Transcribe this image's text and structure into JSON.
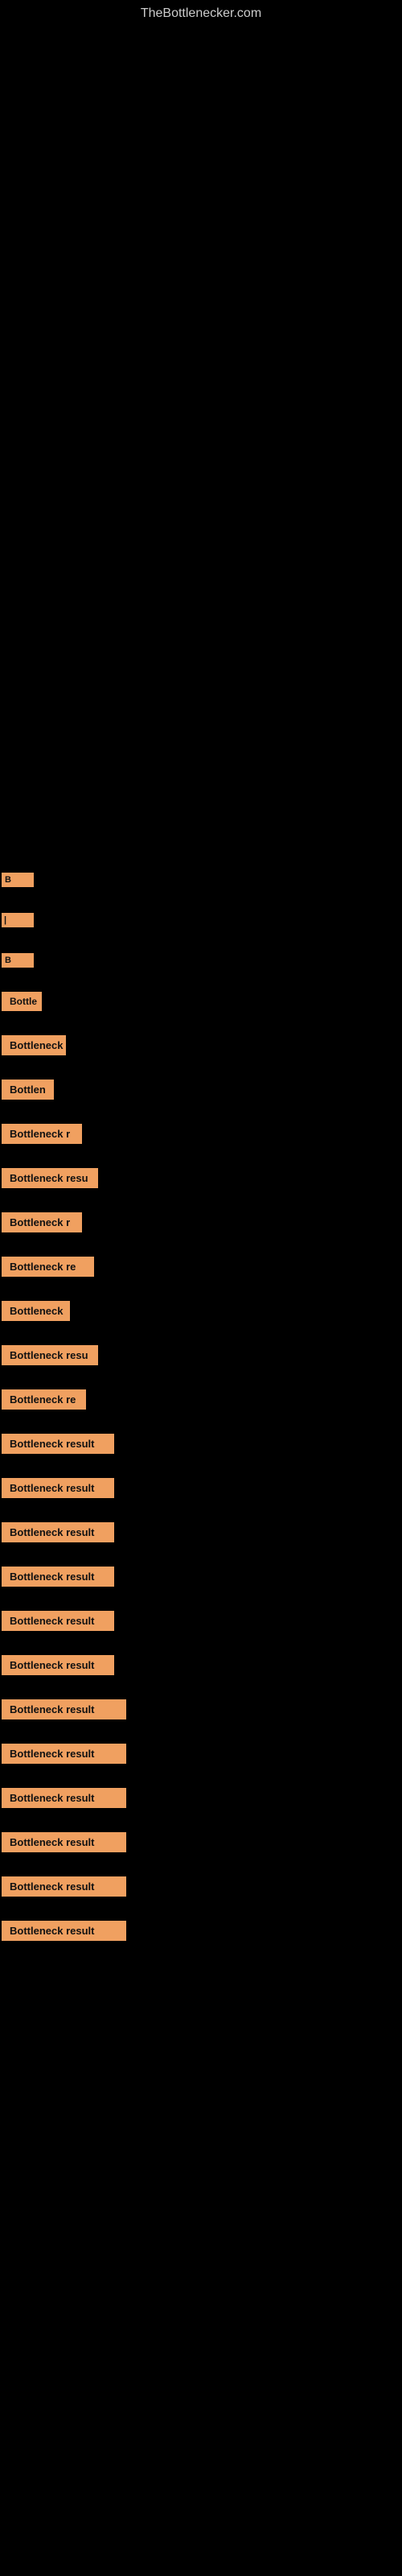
{
  "site": {
    "title": "TheBottlenecker.com"
  },
  "items": [
    {
      "label": "B",
      "width": "very-short",
      "top_gap": 1060
    },
    {
      "label": "|",
      "width": "very-short",
      "top_gap": 30
    },
    {
      "label": "B",
      "width": "very-short",
      "top_gap": 30
    },
    {
      "label": "Bottle",
      "width": "short",
      "top_gap": 20
    },
    {
      "label": "Bottleneck",
      "width": "medium-short",
      "top_gap": 20
    },
    {
      "label": "Bottlen",
      "width": "short",
      "top_gap": 20
    },
    {
      "label": "Bottleneck r",
      "width": "medium",
      "top_gap": 20
    },
    {
      "label": "Bottleneck resu",
      "width": "medium-long",
      "top_gap": 20
    },
    {
      "label": "Bottleneck r",
      "width": "medium",
      "top_gap": 20
    },
    {
      "label": "Bottleneck re",
      "width": "medium-long",
      "top_gap": 20
    },
    {
      "label": "Bottleneck",
      "width": "medium-short",
      "top_gap": 20
    },
    {
      "label": "Bottleneck resu",
      "width": "medium-long",
      "top_gap": 20
    },
    {
      "label": "Bottleneck re",
      "width": "medium",
      "top_gap": 20
    },
    {
      "label": "Bottleneck result",
      "width": "long",
      "top_gap": 20
    },
    {
      "label": "Bottleneck result",
      "width": "long",
      "top_gap": 20
    },
    {
      "label": "Bottleneck result",
      "width": "long",
      "top_gap": 20
    },
    {
      "label": "Bottleneck result",
      "width": "long",
      "top_gap": 20
    },
    {
      "label": "Bottleneck result",
      "width": "long",
      "top_gap": 20
    },
    {
      "label": "Bottleneck result",
      "width": "long",
      "top_gap": 20
    },
    {
      "label": "Bottleneck result",
      "width": "full",
      "top_gap": 20
    },
    {
      "label": "Bottleneck result",
      "width": "full",
      "top_gap": 20
    },
    {
      "label": "Bottleneck result",
      "width": "full",
      "top_gap": 20
    },
    {
      "label": "Bottleneck result",
      "width": "full",
      "top_gap": 20
    },
    {
      "label": "Bottleneck result",
      "width": "full",
      "top_gap": 20
    },
    {
      "label": "Bottleneck result",
      "width": "full",
      "top_gap": 20
    }
  ],
  "colors": {
    "background": "#000000",
    "badge_bg": "#f0a060",
    "badge_text": "#000000",
    "title": "#cccccc"
  }
}
